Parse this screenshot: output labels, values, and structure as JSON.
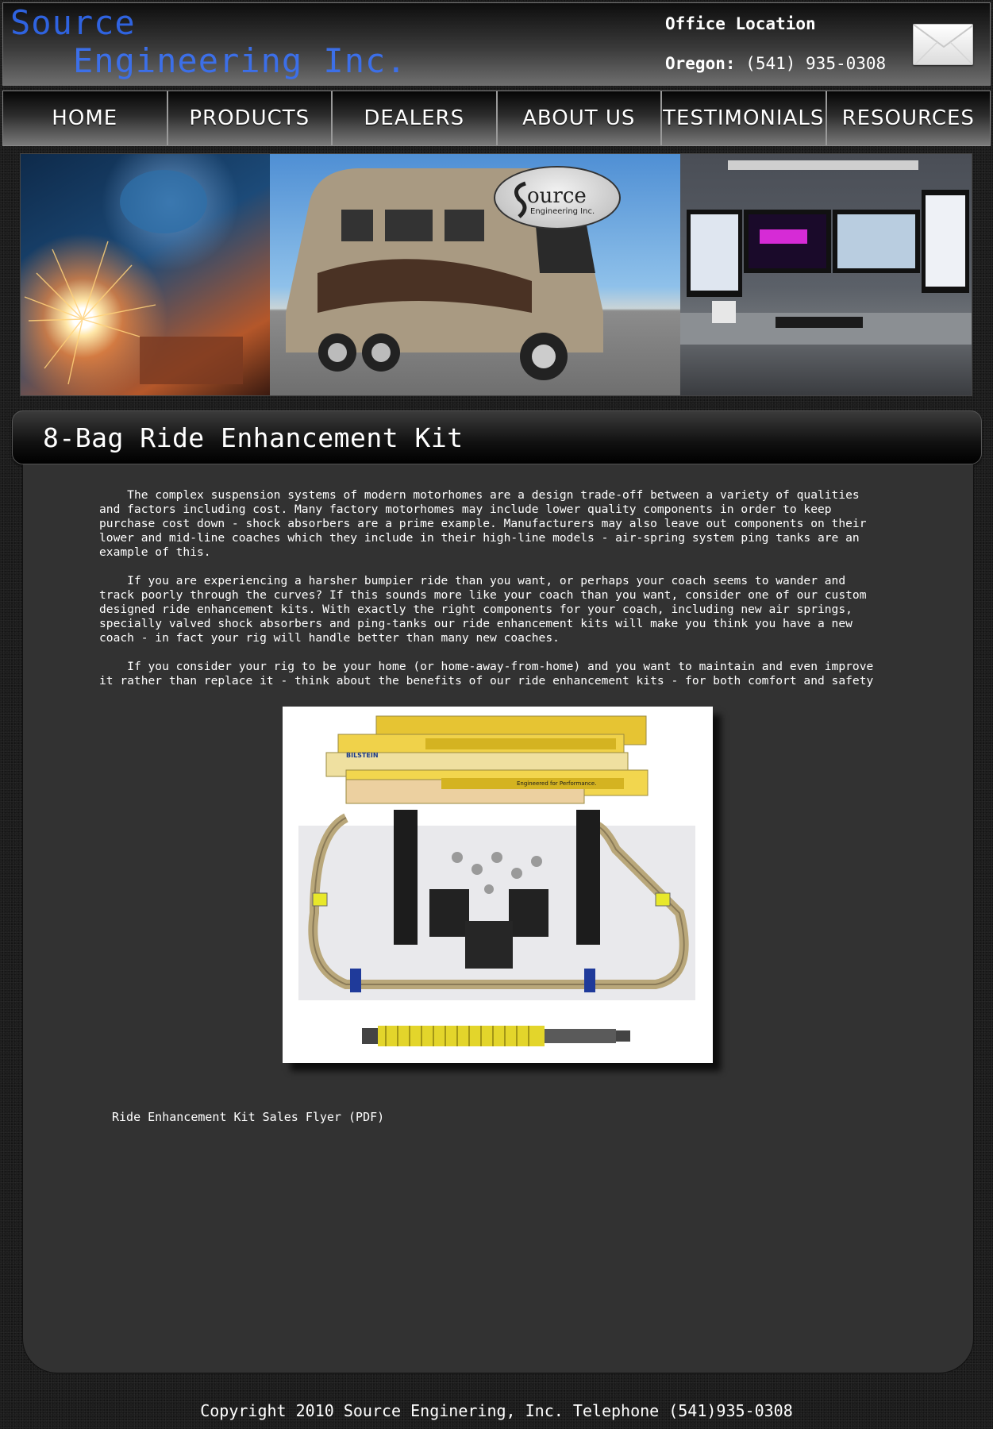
{
  "header": {
    "logo_line1": "Source",
    "logo_line2": "Engineering Inc.",
    "office_title": "Office Location",
    "office_state": "Oregon:",
    "office_phone": "(541) 935-0308",
    "email_icon": "envelope-icon"
  },
  "nav": {
    "items": [
      {
        "label": "HOME"
      },
      {
        "label": "PRODUCTS"
      },
      {
        "label": "DEALERS"
      },
      {
        "label": "ABOUT US"
      },
      {
        "label": "TESTIMONIALS"
      },
      {
        "label": "RESOURCES"
      }
    ]
  },
  "banner": {
    "panels": [
      "welding-photo",
      "motorhome-photo",
      "cad-workstation-photo"
    ],
    "seal_text_1": "ource",
    "seal_text_2": "Engineering Inc."
  },
  "main": {
    "title": "8-Bag Ride Enhancement Kit",
    "paragraphs": [
      "    The complex suspension systems of modern motorhomes are a design trade-off between a variety of qualities\nand factors including cost. Many factory motorhomes may include lower quality components in order to keep\npurchase cost down - shock absorbers are a prime example. Manufacturers may also leave out components on their\nlower and mid-line coaches which they include in their high-line models - air-spring system ping tanks are an\nexample of this.",
      "    If you are experiencing a harsher bumpier ride than you want, or perhaps your coach seems to wander and\ntrack poorly through the curves? If this sounds more like your coach than you want, consider one of our custom\ndesigned ride enhancement kits. With exactly the right components for your coach, including new air springs,\nspecially valved shock absorbers and ping-tanks our ride enhancement kits will make you think you have a new\ncoach - in fact your rig will handle better than many new coaches.",
      "    If you consider your rig to be your home (or home-away-from-home) and you want to maintain and even improve\nit rather than replace it - think about the benefits of our ride enhancement kits - for both comfort and safety"
    ],
    "photo_box_labels": [
      "BILSTEIN",
      "Engineered for Performance."
    ],
    "flyer_link": "Ride Enhancement Kit Sales Flyer (PDF)"
  },
  "footer": {
    "copyright": "Copyright 2010 Source Enginering, Inc. Telephone (541)935-0308"
  }
}
